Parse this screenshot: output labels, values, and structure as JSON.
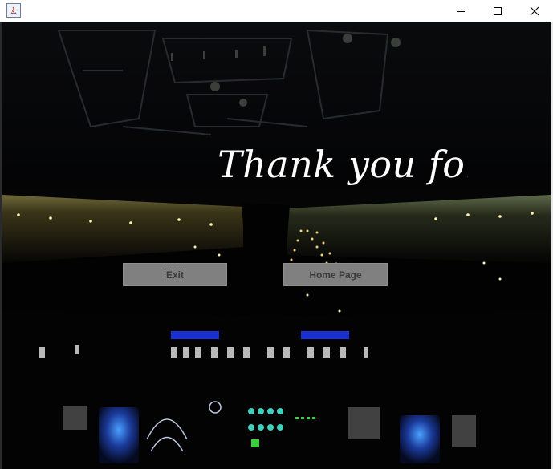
{
  "window": {
    "app_icon": "java-app-icon",
    "controls": [
      "minimize-icon",
      "maximize-icon",
      "close-icon"
    ]
  },
  "main": {
    "headline": "Thank you for v",
    "buttons": {
      "exit_label": "Exit",
      "home_label": "Home Page"
    }
  },
  "colors": {
    "background": "#000000",
    "button_fill": "#808080",
    "button_text": "#3a3a3a",
    "headline_text": "#ffffff"
  }
}
